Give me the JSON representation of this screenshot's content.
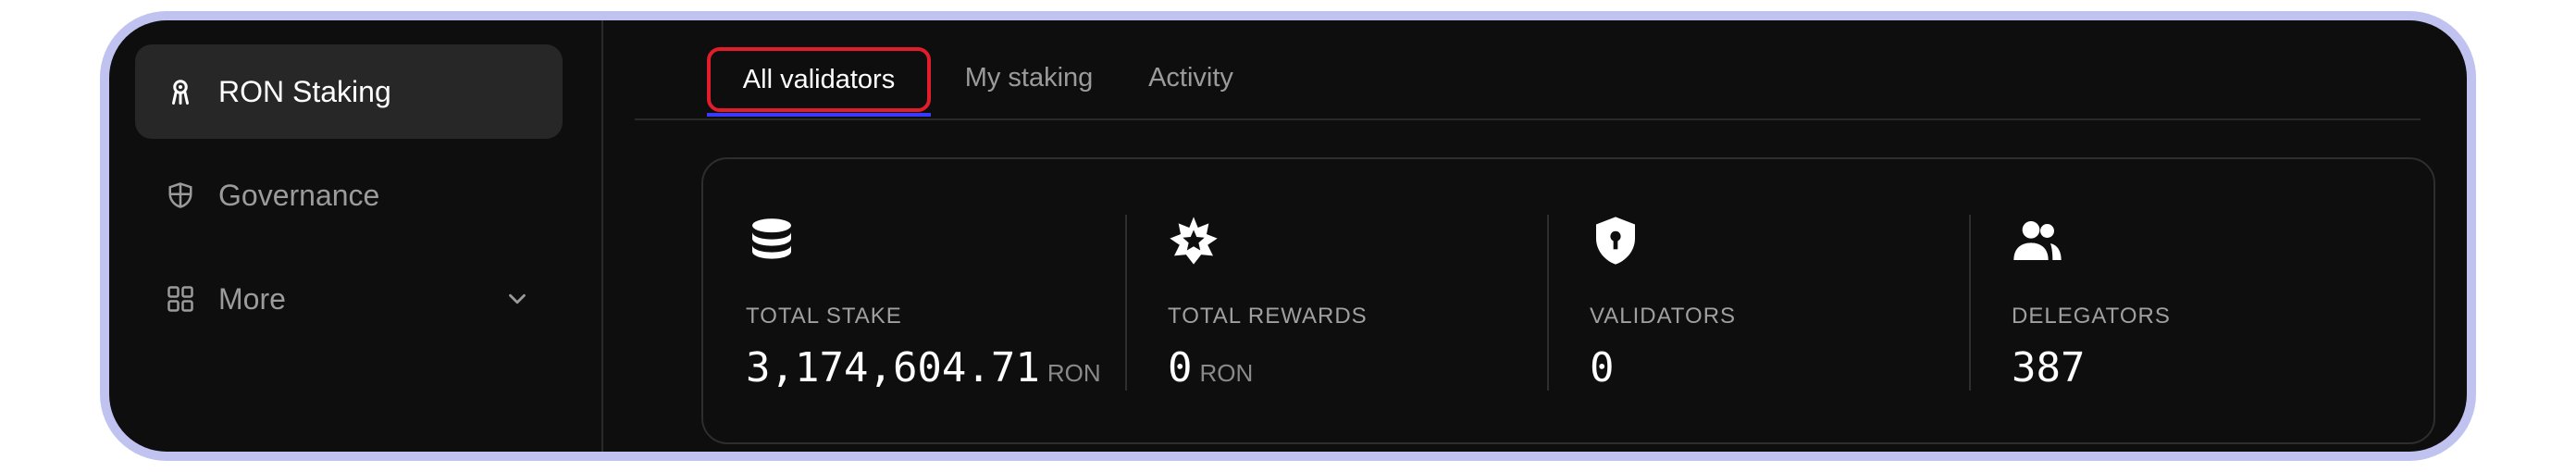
{
  "sidebar": {
    "items": [
      {
        "label": "RON Staking",
        "icon": "staking-icon"
      },
      {
        "label": "Governance",
        "icon": "shield-icon"
      },
      {
        "label": "More",
        "icon": "grid-icon"
      }
    ]
  },
  "tabs": [
    {
      "label": "All validators",
      "active": true
    },
    {
      "label": "My staking"
    },
    {
      "label": "Activity"
    }
  ],
  "stats": [
    {
      "label": "TOTAL STAKE",
      "value": "3,174,604.71",
      "unit": "RON",
      "icon": "coins-stack-icon"
    },
    {
      "label": "TOTAL REWARDS",
      "value": "0",
      "unit": "RON",
      "icon": "star-badge-icon"
    },
    {
      "label": "VALIDATORS",
      "value": "0",
      "icon": "shield-lock-icon"
    },
    {
      "label": "DELEGATORS",
      "value": "387",
      "icon": "users-icon"
    }
  ],
  "colors": {
    "background": "#0e0e0e",
    "frame": "#c0c2ef",
    "highlight": "#e11d2b"
  }
}
